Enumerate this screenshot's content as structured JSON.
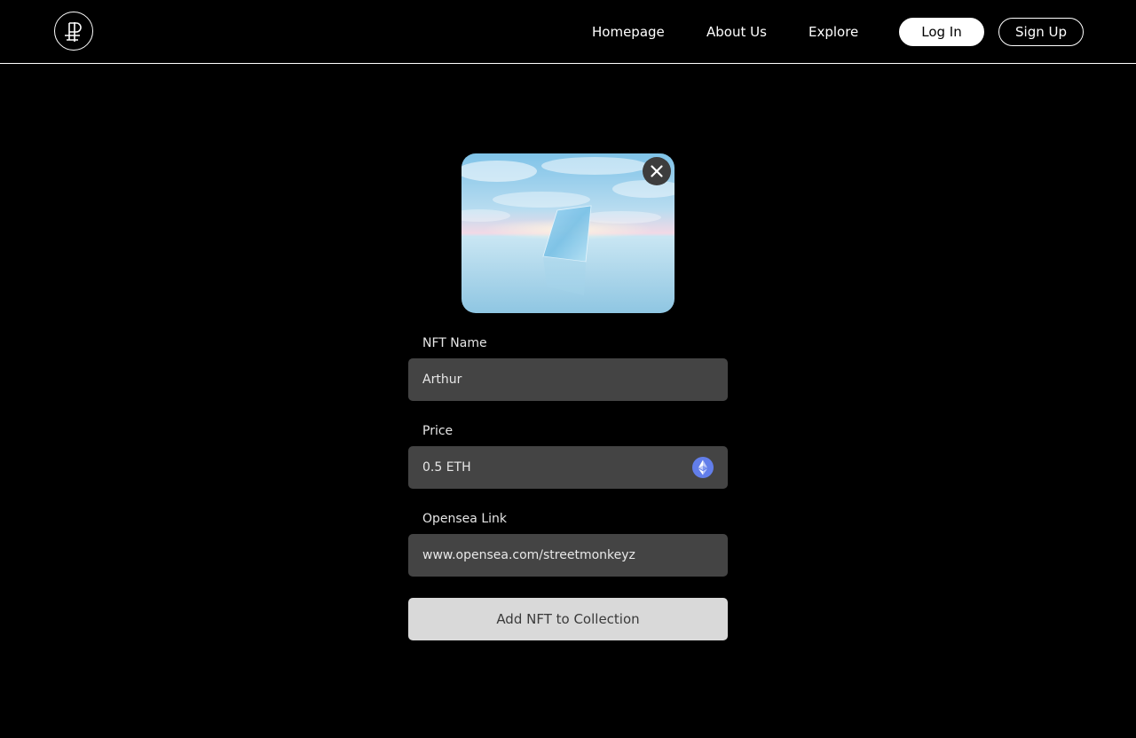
{
  "nav": {
    "logo_icon": "p-monogram-logo",
    "links": [
      "Homepage",
      "About Us",
      "Explore"
    ],
    "login_label": "Log In",
    "signup_label": "Sign Up"
  },
  "preview": {
    "image_desc_icon": "nft-image",
    "close_icon": "close-icon"
  },
  "form": {
    "name": {
      "label": "NFT Name",
      "value": "Arthur"
    },
    "price": {
      "label": "Price",
      "value": "0.5 ETH",
      "icon": "ethereum-icon"
    },
    "link": {
      "label": "Opensea Link",
      "value": "www.opensea.com/streetmonkeyz"
    },
    "submit_label": "Add NFT to Collection"
  },
  "colors": {
    "background": "#000000",
    "field": "#444444",
    "submit": "#d9d9d9",
    "eth": "#627eea"
  }
}
